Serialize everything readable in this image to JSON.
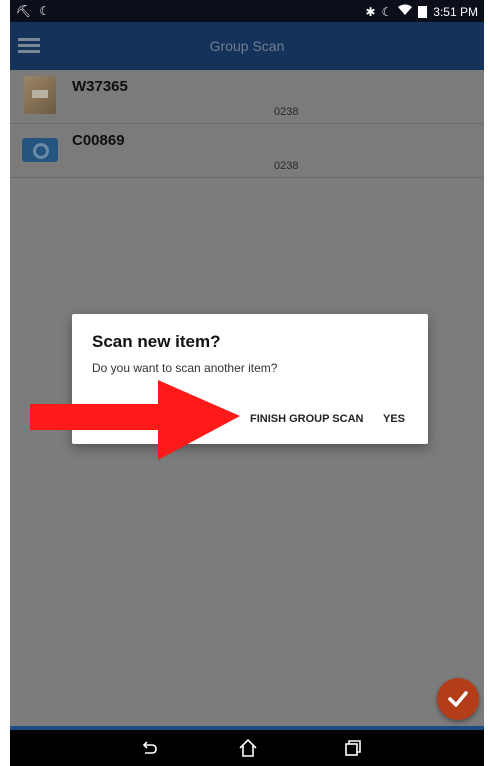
{
  "status_bar": {
    "time": "3:51 PM",
    "left_icons": [
      "usb-icon",
      "moon-icon"
    ],
    "right_icons": [
      "bluetooth-icon",
      "moon-icon",
      "wifi-icon",
      "battery-icon"
    ]
  },
  "app_bar": {
    "title": "Group Scan",
    "menu_icon": "menu-icon"
  },
  "items": [
    {
      "id": "W37365",
      "code": "0238",
      "thumbnail": "photo-thumbnail"
    },
    {
      "id": "C00869",
      "code": "0238",
      "thumbnail": "camera-icon"
    }
  ],
  "dialog": {
    "title": "Scan new item?",
    "message": "Do you want to scan another item?",
    "finish_label": "FINISH GROUP SCAN",
    "yes_label": "YES"
  },
  "fab": {
    "icon": "check-icon",
    "color": "#b33d19"
  },
  "colors": {
    "app_bar": "#15325a",
    "overlay": "#7c7c7c",
    "arrow": "#ff1a1a",
    "nav_bar": "#000000"
  },
  "nav_bar": {
    "icons": [
      "back-icon",
      "home-icon",
      "recents-icon"
    ]
  }
}
